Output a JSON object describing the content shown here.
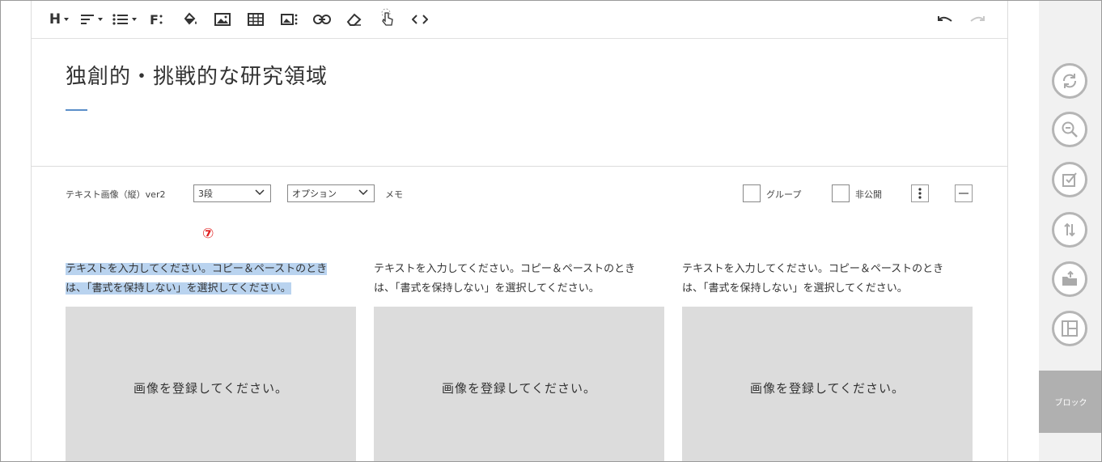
{
  "page": {
    "title": "独創的・挑戦的な研究領域"
  },
  "toolbar": {
    "heading_label": "H",
    "font_label": "F"
  },
  "block": {
    "type_label": "テキスト画像（縦）ver2",
    "columns_select": "3段",
    "option_select": "オプション",
    "memo_label": "メモ",
    "group_label": "グループ",
    "private_label": "非公開"
  },
  "marker": "⑦",
  "columns": [
    {
      "text_line1": "テキストを入力してください。コピー＆ペーストのとき",
      "text_line2": "は、「書式を保持しない」を選択してください。",
      "image_placeholder": "画像を登録してください。"
    },
    {
      "text_line1": "テキストを入力してください。コピー＆ペーストのとき",
      "text_line2": "は、「書式を保持しない」を選択してください。",
      "image_placeholder": "画像を登録してください。"
    },
    {
      "text_line1": "テキストを入力してください。コピー＆ペーストのとき",
      "text_line2": "は、「書式を保持しない」を選択してください。",
      "image_placeholder": "画像を登録してください。"
    }
  ],
  "sidebar": {
    "block_label": "ブロック"
  },
  "colors": {
    "accent_underline": "#5b8fc9",
    "selection": "#b9d3ef",
    "marker": "#e02020",
    "placeholder_bg": "#dcdcdc"
  },
  "icons": [
    "format-align-icon",
    "list-icon",
    "fill-color-icon",
    "image-icon",
    "table-icon",
    "image-grid-icon",
    "link-icon",
    "eraser-icon",
    "pointer-icon",
    "code-icon",
    "undo-icon",
    "redo-icon",
    "refresh-icon",
    "zoom-icon",
    "checkbox-icon",
    "sort-icon",
    "export-icon",
    "layout-icon"
  ]
}
